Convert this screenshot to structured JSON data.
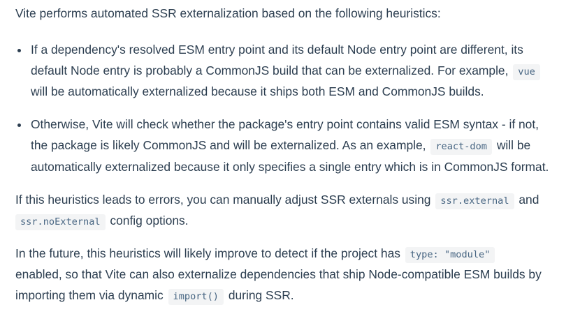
{
  "intro": "Vite performs automated SSR externalization based on the following heuristics:",
  "bullet1": {
    "line1": "If a dependency's resolved ESM entry point and its default Node entry point are different, its",
    "line2_text": "default Node entry is probably a CommonJS build that can be externalized. For example,",
    "line2_code": "vue",
    "line3": "will be automatically externalized because it ships both ESM and CommonJS builds."
  },
  "bullet2": {
    "line1": "Otherwise, Vite will check whether the package's entry point contains valid ESM syntax - if not,",
    "line2_text_a": "the package is likely CommonJS and will be externalized. As an example,",
    "line2_code": "react-dom",
    "line2_text_b": "will be",
    "line3": "automatically externalized because it only specifies a single entry which is in CommonJS format."
  },
  "para2": {
    "line1_text": "If this heuristics leads to errors, you can manually adjust SSR externals using",
    "line1_code": "ssr.external",
    "line1_tail": "and",
    "line2_code": "ssr.noExternal",
    "line2_text": "config options."
  },
  "para3": {
    "line1_text": "In the future, this heuristics will likely improve to detect if the project has",
    "line1_code": "type: \"module\"",
    "line2": "enabled, so that Vite can also externalize dependencies that ship Node-compatible ESM builds by",
    "line3_text": "importing them via dynamic",
    "line3_code": "import()",
    "line3_tail": "during SSR."
  }
}
